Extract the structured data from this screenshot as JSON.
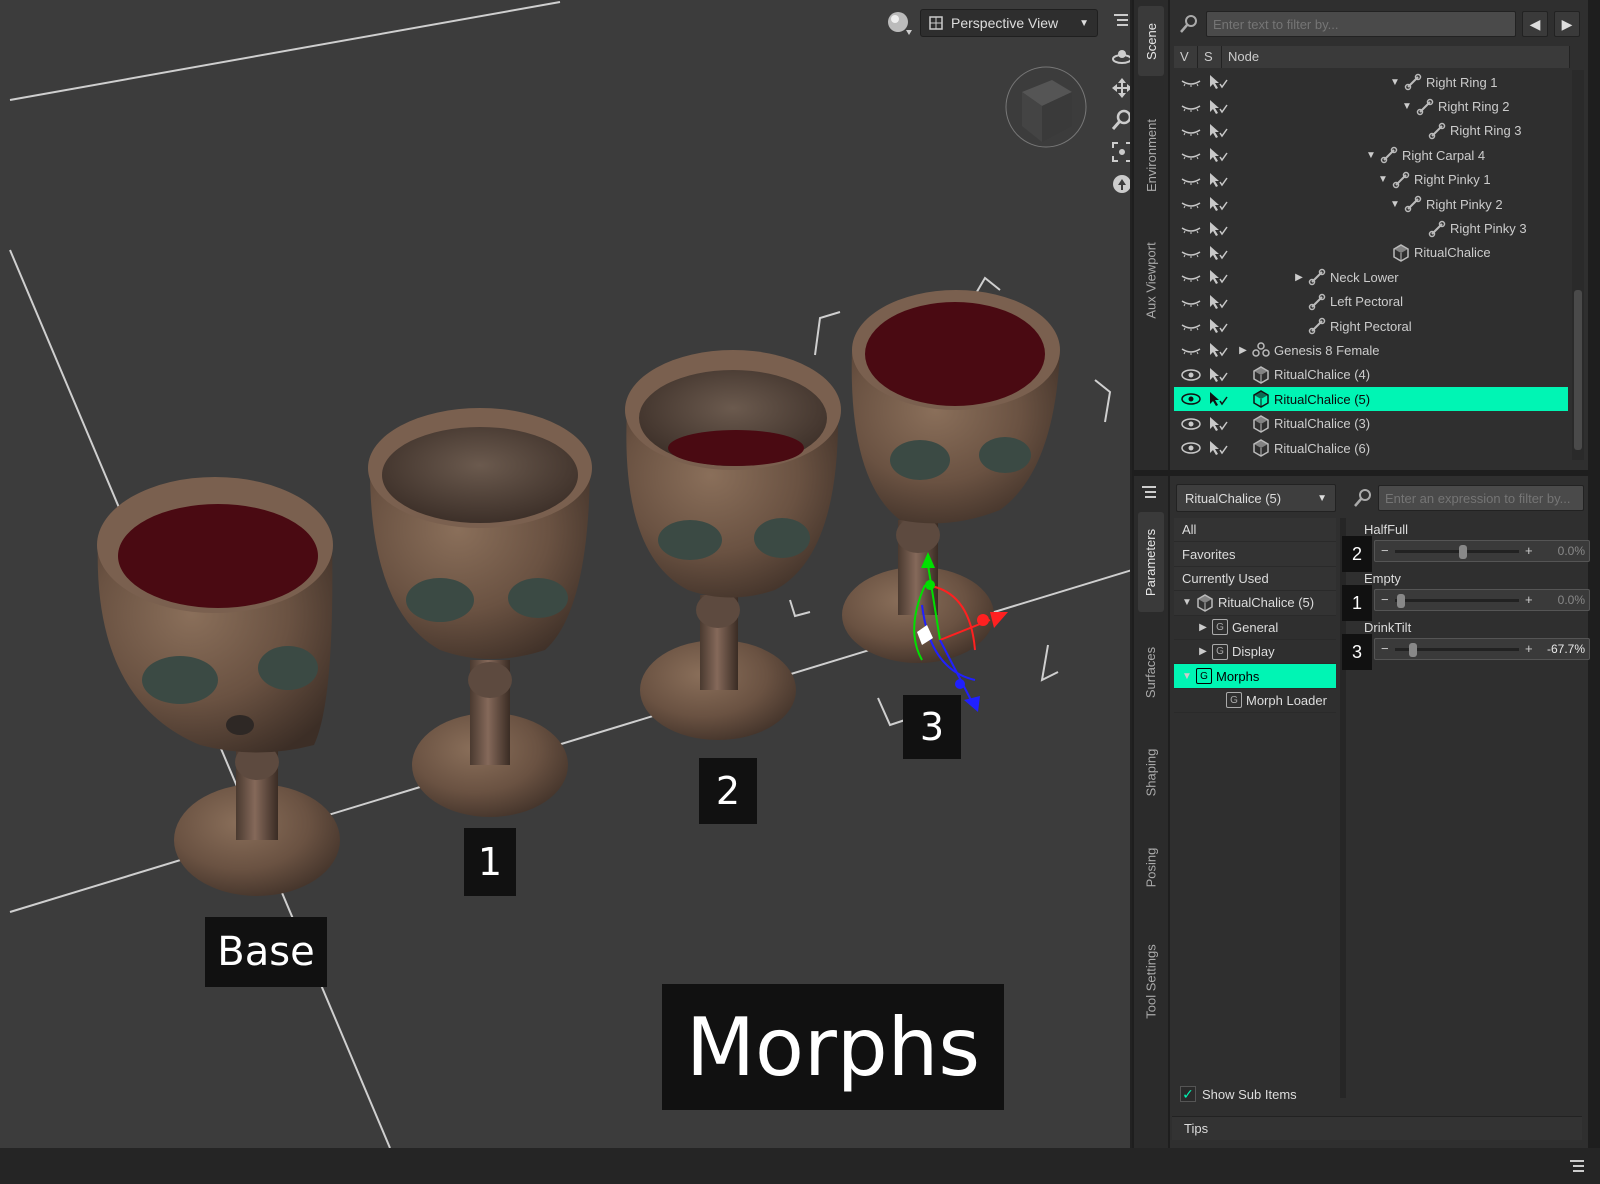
{
  "viewport": {
    "view_name": "Perspective View",
    "labels": {
      "base": "Base",
      "one": "1",
      "two": "2",
      "three": "3",
      "morphs": "Morphs"
    }
  },
  "side_tabs_top": [
    "Scene",
    "Environment",
    "Aux Viewport"
  ],
  "side_tabs_bottom": [
    "Parameters",
    "Surfaces",
    "Shaping",
    "Posing",
    "Tool Settings"
  ],
  "scene": {
    "filter_placeholder": "Enter text to filter by...",
    "columns": {
      "v": "V",
      "s": "S",
      "node": "Node"
    },
    "nodes": [
      {
        "label": "Right Ring 1",
        "icon": "bone-icon",
        "twisty": "down"
      },
      {
        "label": "Right Ring 2",
        "icon": "bone-icon",
        "twisty": "down"
      },
      {
        "label": "Right Ring 3",
        "icon": "bone-icon",
        "twisty": ""
      },
      {
        "label": "Right Carpal 4",
        "icon": "bone-icon",
        "twisty": "down"
      },
      {
        "label": "Right Pinky 1",
        "icon": "bone-icon",
        "twisty": "down"
      },
      {
        "label": "Right Pinky 2",
        "icon": "bone-icon",
        "twisty": "down"
      },
      {
        "label": "Right Pinky 3",
        "icon": "bone-icon",
        "twisty": ""
      },
      {
        "label": "RitualChalice",
        "icon": "prop-icon",
        "twisty": ""
      },
      {
        "label": "Neck Lower",
        "icon": "bone-icon",
        "twisty": "right"
      },
      {
        "label": "Left Pectoral",
        "icon": "bone-icon",
        "twisty": ""
      },
      {
        "label": "Right Pectoral",
        "icon": "bone-icon",
        "twisty": ""
      },
      {
        "label": "Genesis 8 Female",
        "icon": "figure-icon",
        "twisty": "right"
      },
      {
        "label": "RitualChalice (4)",
        "icon": "prop-icon",
        "twisty": ""
      },
      {
        "label": "RitualChalice (5)",
        "icon": "prop-icon",
        "twisty": "",
        "selected": true
      },
      {
        "label": "RitualChalice (3)",
        "icon": "prop-icon",
        "twisty": ""
      },
      {
        "label": "RitualChalice (6)",
        "icon": "prop-icon",
        "twisty": ""
      }
    ]
  },
  "parameters": {
    "node_select": "RitualChalice (5)",
    "filter_placeholder": "Enter an expression to filter by...",
    "tree": [
      {
        "label": "All"
      },
      {
        "label": "Favorites"
      },
      {
        "label": "Currently Used"
      },
      {
        "label": "RitualChalice (5)",
        "twisty": "down",
        "icon": "prop-icon"
      },
      {
        "label": "General",
        "twisty": "right",
        "icon": "group-icon"
      },
      {
        "label": "Display",
        "twisty": "right",
        "icon": "group-icon"
      },
      {
        "label": "Morphs",
        "twisty": "down",
        "icon": "group-icon",
        "selected": true
      },
      {
        "label": "Morph Loader",
        "twisty": "",
        "icon": "group-icon"
      }
    ],
    "sliders": [
      {
        "name": "HalfFull",
        "value": "0.0%",
        "callout": "2",
        "knob_fraction": 0.55,
        "active": false
      },
      {
        "name": "Empty",
        "value": "0.0%",
        "callout": "1",
        "knob_fraction": 0.02,
        "active": false
      },
      {
        "name": "DrinkTilt",
        "value": "-67.7%",
        "callout": "3",
        "knob_fraction": 0.12,
        "active": true
      }
    ],
    "show_sub_items": "Show Sub Items",
    "tips": "Tips"
  },
  "colors": {
    "selection": "#00f5b4",
    "wine": "#4a0a12"
  }
}
